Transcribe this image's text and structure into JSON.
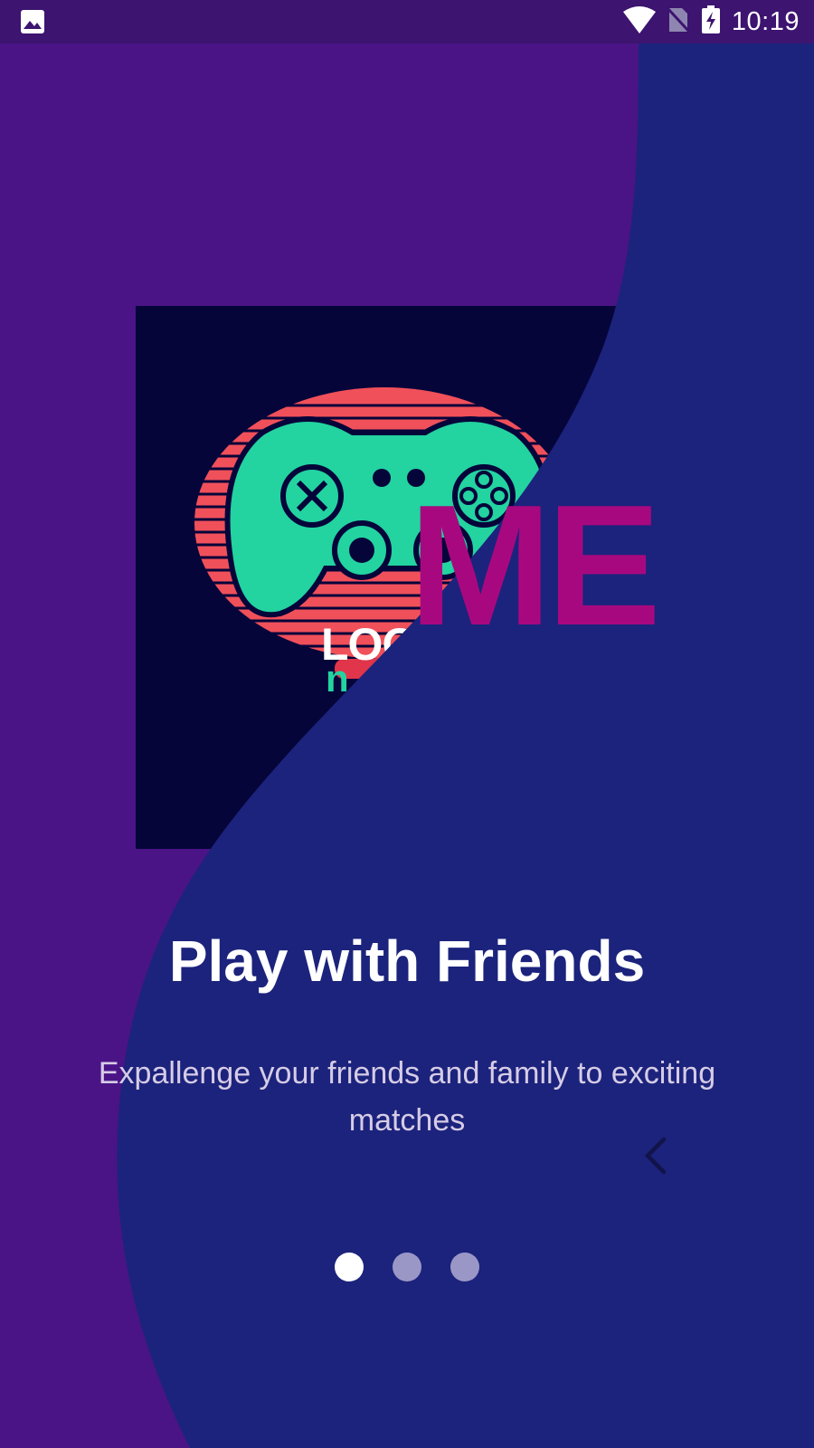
{
  "status_bar": {
    "time": "10:19",
    "icons": [
      "image-icon",
      "wifi-icon",
      "no-sim-icon",
      "battery-charging-icon"
    ]
  },
  "artwork": {
    "logo_line1": "LOO",
    "logo_line2": "n",
    "brand_text": "ME"
  },
  "onboarding": {
    "title": "Play with Friends",
    "subtitle": "Expallenge your friends and family to exciting matches",
    "back_icon": "chevron-left-icon",
    "pages": 3,
    "current_page": 1
  },
  "colors": {
    "purple_bg": "#4a1486",
    "wave_navy": "#1c237c",
    "brand_magenta": "#a8087f",
    "controller_teal": "#23d3a0",
    "glow_red": "#f0505a"
  }
}
